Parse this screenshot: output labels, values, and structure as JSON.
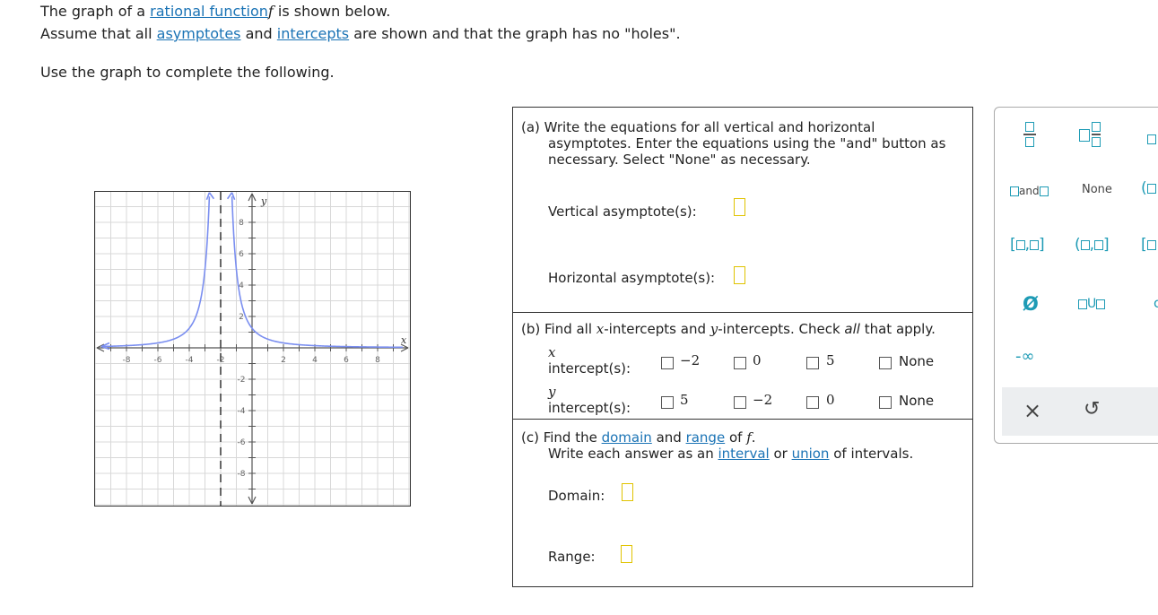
{
  "intro": {
    "line1": {
      "pre": "The graph of a ",
      "link": "rational function",
      "var": "f",
      "post": " is shown below."
    },
    "line2": {
      "pre": "Assume that all ",
      "link1": "asymptotes",
      "mid": " and ",
      "link2": "intercepts",
      "post": " are shown and that the graph has no \"holes\"."
    },
    "line3": "Use the graph to complete the following."
  },
  "graph": {
    "x_label": "x",
    "y_label": "y",
    "x_ticks": [
      "-8",
      "-6",
      "-4",
      "-2",
      "2",
      "4",
      "6",
      "8"
    ],
    "y_ticks": [
      "8",
      "6",
      "4",
      "2",
      "-2",
      "-4",
      "-6",
      "-8"
    ],
    "grid_color": "#d8d8d8",
    "curve_color": "#7a8ef0",
    "asymptote_color": "#333333"
  },
  "part_a": {
    "line1": "(a) Write the equations for all vertical and horizontal",
    "line2": "asymptotes. Enter the equations using the \"and\" button as",
    "line3": "necessary. Select \"None\" as necessary.",
    "vertical_label": "Vertical asymptote(s):",
    "horizontal_label": "Horizontal asymptote(s):"
  },
  "part_b": {
    "pre": "(b) Find all ",
    "x_var": "x",
    "mid1": "-intercepts and ",
    "y_var": "y",
    "mid2": "-intercepts. Check ",
    "all": "all",
    "post": " that apply.",
    "x_label_var": "x",
    "x_label_text": "intercept(s):",
    "y_label_var": "y",
    "y_label_text": "intercept(s):",
    "x_options": [
      "−2",
      "0",
      "5",
      "None"
    ],
    "y_options": [
      "5",
      "−2",
      "0",
      "None"
    ]
  },
  "part_c": {
    "pre": "(c) Find the ",
    "link1": "domain",
    "mid1": " and ",
    "link2": "range",
    "mid2": " of ",
    "var": "f",
    "post": ".",
    "line2_pre": "Write each answer as an ",
    "line2_link1": "interval",
    "line2_mid": " or ",
    "line2_link2": "union",
    "line2_post": " of intervals.",
    "domain_label": "Domain:",
    "range_label": "Range:"
  },
  "toolbar": {
    "and_label": "and",
    "none_label": "None",
    "empty_set": "Ø",
    "union_symbol": "U",
    "neg_infinity": "-∞",
    "clear_icon": "×",
    "undo_icon": "↺",
    "accent_color": "#1e9bb5"
  }
}
